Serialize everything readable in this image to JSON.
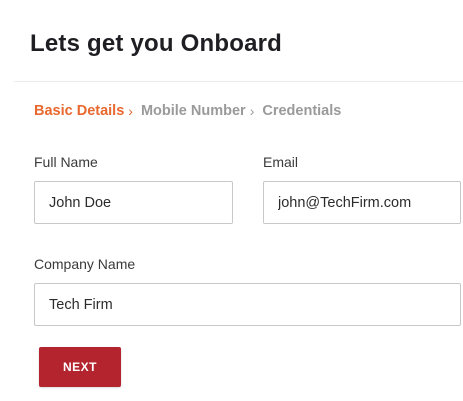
{
  "page": {
    "title": "Lets get you Onboard"
  },
  "steps": [
    {
      "label": "Basic Details",
      "state": "active"
    },
    {
      "label": "Mobile Number",
      "state": "inactive"
    },
    {
      "label": "Credentials",
      "state": "inactive"
    }
  ],
  "separator": "›",
  "form": {
    "full_name": {
      "label": "Full Name",
      "value": "John Doe"
    },
    "email": {
      "label": "Email",
      "value": "john@TechFirm.com"
    },
    "company_name": {
      "label": "Company Name",
      "value": "Tech Firm"
    }
  },
  "actions": {
    "next_label": "NEXT"
  },
  "colors": {
    "accent": "#e8682f",
    "button": "#b3242e",
    "inactive_step": "#9a9a9a"
  }
}
